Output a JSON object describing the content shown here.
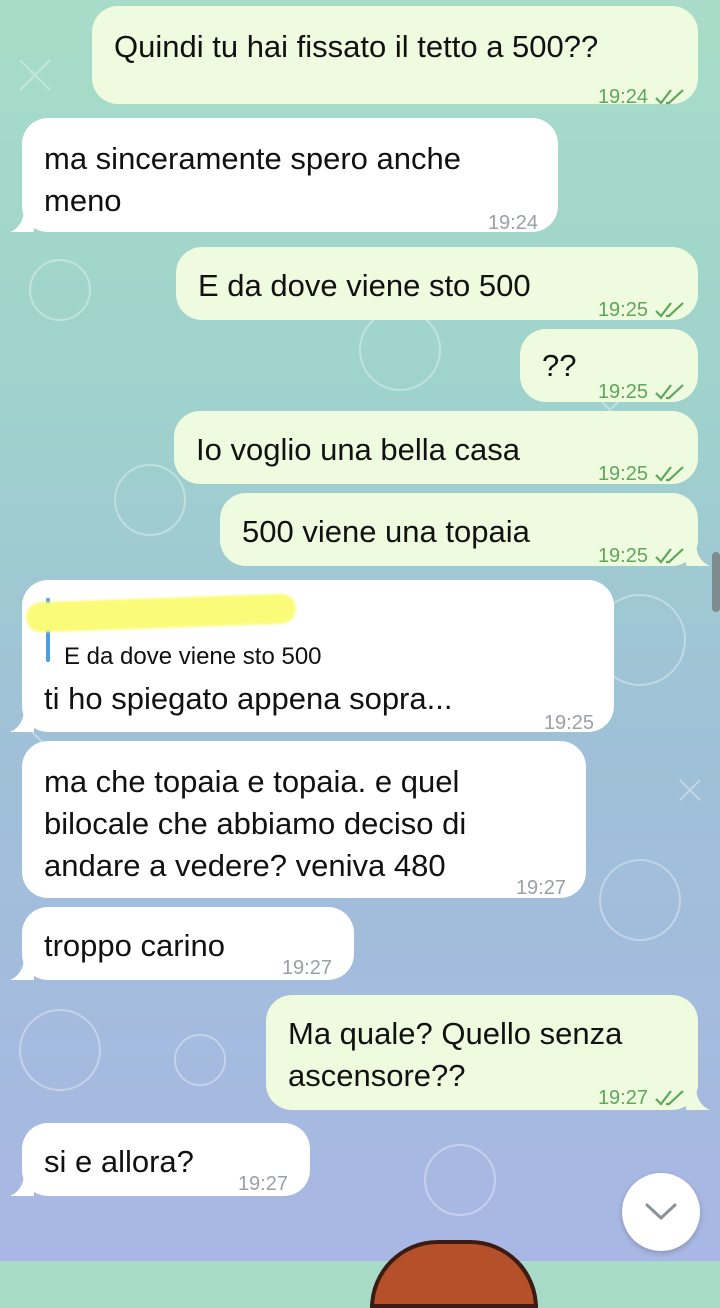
{
  "messages": [
    {
      "text": "Quindi tu hai fissato il tetto a 500??",
      "time": "19:24"
    },
    {
      "text": "ma sinceramente spero anche\nmeno",
      "time": "19:24"
    },
    {
      "text": "E da dove viene sto 500",
      "time": "19:25"
    },
    {
      "text": "??",
      "time": "19:25"
    },
    {
      "text": "Io voglio una bella casa",
      "time": "19:25"
    },
    {
      "text": "500 viene una topaia",
      "time": "19:25"
    },
    {
      "text": "ti ho spiegato appena sopra...",
      "time": "19:25",
      "reply_text": "E da dove viene sto 500"
    },
    {
      "text": "ma che topaia e topaia. e quel\nbilocale che abbiamo deciso di\nandare a vedere? veniva 480",
      "time": "19:27"
    },
    {
      "text": "troppo carino",
      "time": "19:27"
    },
    {
      "text": "Ma quale? Quello senza\nascensore??",
      "time": "19:27"
    },
    {
      "text": "si e allora?",
      "time": "19:27"
    }
  ],
  "colors": {
    "outgoing_bubble": "#eefbdf",
    "incoming_bubble": "#ffffff",
    "read_ticks": "#5fa55a",
    "reply_bar": "#4b9fe0"
  },
  "icons": {
    "read_status": "double-check-icon",
    "scroll_down": "chevron-down-icon"
  }
}
